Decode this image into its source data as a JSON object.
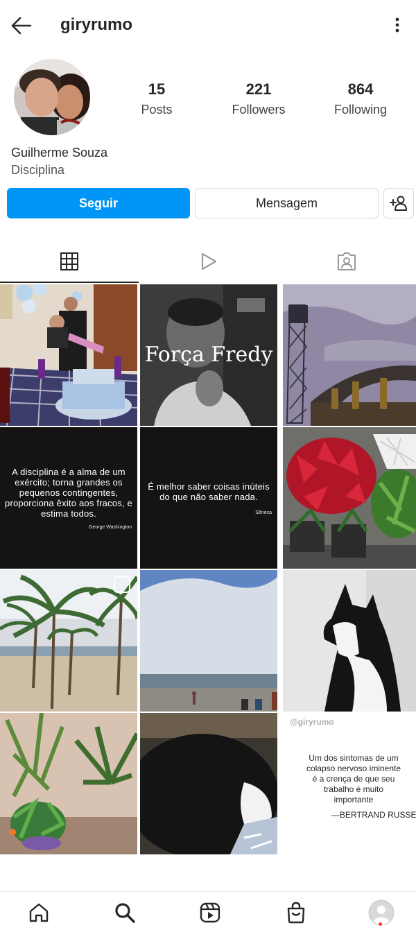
{
  "header": {
    "username": "giryrumo",
    "back_icon": "arrow-left-icon",
    "more_icon": "more-vertical-icon"
  },
  "profile": {
    "name": "Guilherme Souza",
    "bio": "Disciplina",
    "stats": {
      "posts": {
        "value": "15",
        "label": "Posts"
      },
      "followers": {
        "value": "221",
        "label": "Followers"
      },
      "following": {
        "value": "864",
        "label": "Following"
      }
    }
  },
  "actions": {
    "follow_label": "Seguir",
    "message_label": "Mensagem",
    "add_user_icon": "add-user-icon"
  },
  "tabs": [
    {
      "name": "grid",
      "icon": "grid-icon",
      "active": true
    },
    {
      "name": "reels",
      "icon": "reels-play-icon",
      "active": false
    },
    {
      "name": "tagged",
      "icon": "tagged-user-icon",
      "active": false
    }
  ],
  "posts": {
    "forca_text": "Força Fredy",
    "quote1": {
      "text": "A disciplina é a alma de um exército; torna grandes os pequenos contingentes, proporciona êxito aos fracos, e estima todos.",
      "author": "George Washington"
    },
    "quote2": {
      "text": "É melhor saber coisas inúteis do que não saber nada.",
      "author": "Sêneca"
    },
    "quote3": {
      "handle": "@giryrumo",
      "text": "Um dos sintomas de um colapso nervoso iminente é a crença de que seu trabalho é muito importante",
      "author": "—BERTRAND RUSSELL"
    }
  },
  "bottom_nav": [
    {
      "name": "home",
      "icon": "home-icon"
    },
    {
      "name": "search",
      "icon": "search-icon"
    },
    {
      "name": "reels",
      "icon": "reels-icon"
    },
    {
      "name": "shop",
      "icon": "shop-bag-icon"
    },
    {
      "name": "profile",
      "icon": "avatar-icon"
    }
  ],
  "colors": {
    "primary_button": "#0095f6",
    "text": "#262626",
    "border": "#dbdbdb",
    "notification_dot": "#ff3040"
  }
}
